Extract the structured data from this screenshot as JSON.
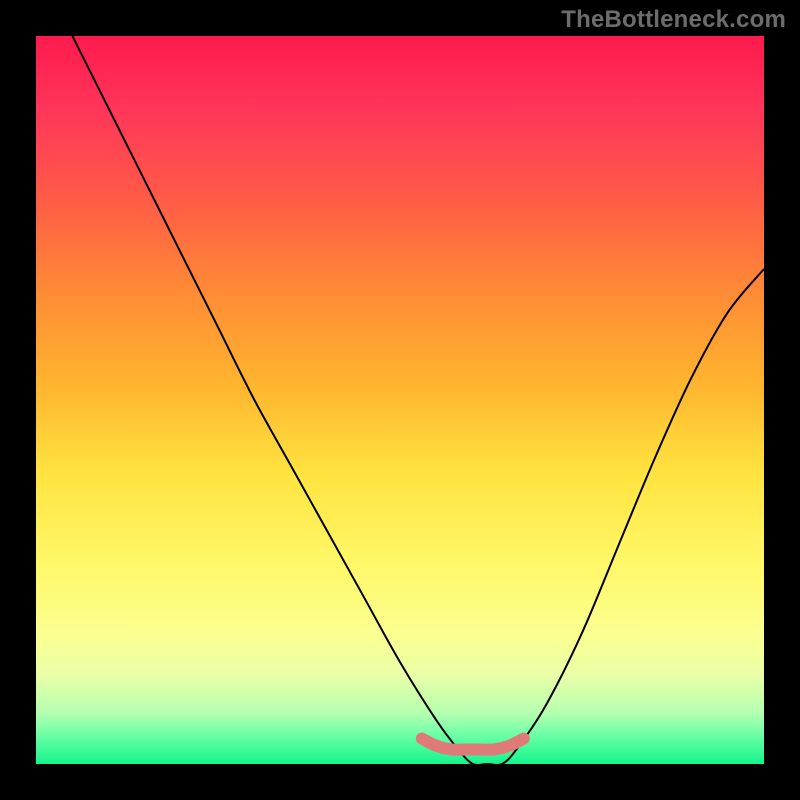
{
  "watermark": "TheBottleneck.com",
  "chart_data": {
    "type": "line",
    "title": "",
    "xlabel": "",
    "ylabel": "",
    "xlim": [
      0,
      100
    ],
    "ylim": [
      0,
      100
    ],
    "grid": false,
    "legend": false,
    "series": [
      {
        "name": "black-curve",
        "x": [
          5,
          10,
          15,
          20,
          25,
          30,
          35,
          40,
          45,
          50,
          55,
          58,
          60,
          62,
          64,
          66,
          70,
          75,
          80,
          85,
          90,
          95,
          100
        ],
        "y": [
          100,
          90,
          80,
          70,
          60,
          50,
          41,
          32,
          23,
          14,
          6,
          2,
          0,
          0,
          0,
          2,
          8,
          18,
          30,
          42,
          53,
          62,
          68
        ]
      },
      {
        "name": "floor-highlight",
        "x": [
          53,
          55,
          57,
          59,
          61,
          63,
          65,
          67
        ],
        "y": [
          3.5,
          2.5,
          2,
          2,
          2,
          2,
          2.5,
          3.5
        ]
      }
    ]
  }
}
